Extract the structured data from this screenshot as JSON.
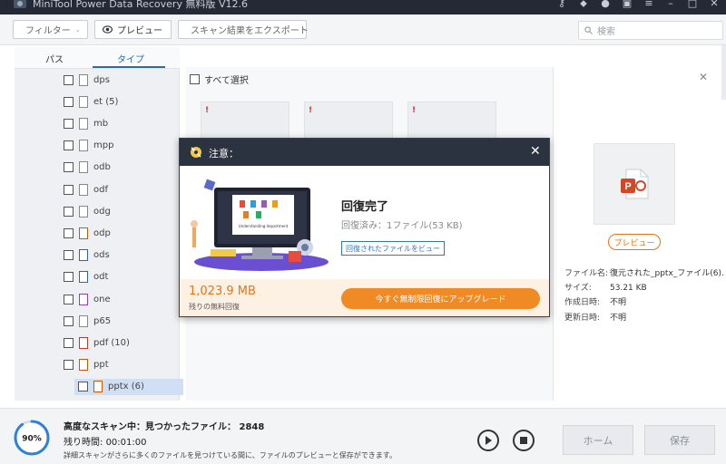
{
  "app": {
    "title": "MiniTool Power Data Recovery 無料版 V12.6"
  },
  "toolbar": {
    "filter_label": "フィルター",
    "preview_label": "プレビュー",
    "export_label": "スキャン結果をエクスポート",
    "search_placeholder": "検索"
  },
  "tabs": {
    "path": "パス",
    "type": "タイプ"
  },
  "file_types": [
    {
      "label": "dps",
      "icon": "file-icon"
    },
    {
      "label": "et (5)",
      "icon": "file-icon"
    },
    {
      "label": "mb",
      "icon": "file-icon"
    },
    {
      "label": "mpp",
      "icon": "file-icon"
    },
    {
      "label": "odb",
      "icon": "file-icon"
    },
    {
      "label": "odf",
      "icon": "file-icon"
    },
    {
      "label": "odg",
      "icon": "file-icon"
    },
    {
      "label": "odp",
      "icon": "odp-file-icon"
    },
    {
      "label": "ods",
      "icon": "ods-file-icon"
    },
    {
      "label": "odt",
      "icon": "odt-file-icon"
    },
    {
      "label": "one",
      "icon": "onenote-file-icon"
    },
    {
      "label": "p65",
      "icon": "file-icon"
    },
    {
      "label": "pdf (10)",
      "icon": "pdf-file-icon"
    },
    {
      "label": "ppt",
      "icon": "ppt-file-icon"
    },
    {
      "label": "pptx (6)",
      "icon": "pptx-file-icon",
      "selected": true
    }
  ],
  "content": {
    "select_all": "すべて選択"
  },
  "preview_panel": {
    "preview_button": "プレビュー",
    "filename_label": "ファイル名:",
    "filename_value": "復元された_pptx_ファイル(6).",
    "size_label": "サイズ:",
    "size_value": "53.21 KB",
    "created_label": "作成日時:",
    "created_value": "不明",
    "modified_label": "更新日時:",
    "modified_value": "不明"
  },
  "modal": {
    "title": "注意：",
    "heading": "回復完了",
    "recovered": "回復済み：1ファイル(53 KB)",
    "view_button": "回復されたファイルをビュー",
    "free_size": "1,023.9 MB",
    "free_label": "残りの無料回復",
    "upgrade_button": "今すぐ無制限回復にアップグレード",
    "illustration_caption": "Understanding department"
  },
  "status": {
    "progress_percent": "90%",
    "progress_value": 0.9,
    "scan_title": "高度なスキャン中：見つかったファイル： 2848",
    "remaining_label": "残り時間:",
    "remaining_value": "00:01:00",
    "note": "詳細スキャンがさらに多くのファイルを見つけている間に、ファイルのプレビューと保存ができます。",
    "home_button": "ホーム",
    "save_button": "保存"
  },
  "colors": {
    "accent_orange": "#f08a24",
    "accent_blue": "#2b6cb0",
    "titlebar": "#232a36"
  }
}
